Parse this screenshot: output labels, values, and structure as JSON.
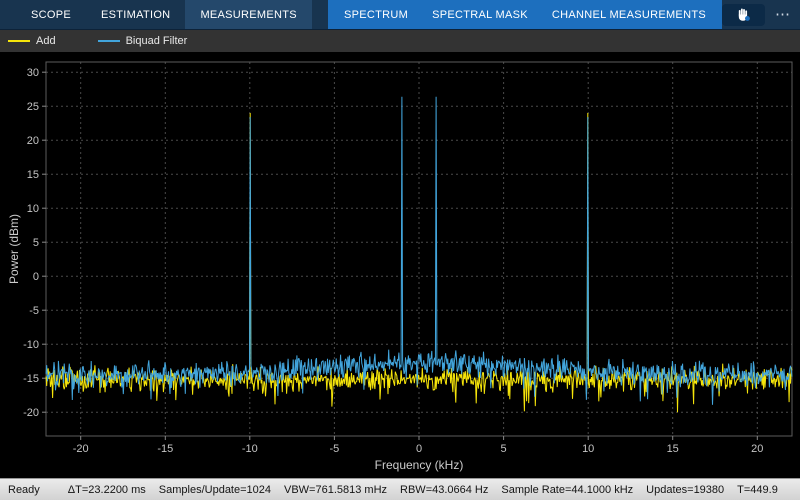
{
  "toolbar": {
    "tabs": [
      {
        "label": "SCOPE"
      },
      {
        "label": "ESTIMATION"
      },
      {
        "label": "MEASUREMENTS",
        "selected": true
      },
      {
        "label": "SPECTRUM"
      },
      {
        "label": "SPECTRAL MASK"
      },
      {
        "label": "CHANNEL MEASUREMENTS"
      }
    ],
    "blue_section_color": "#1d6fbe",
    "bar_color": "#18344f",
    "hand_icon": "hand-icon",
    "more_glyph": "⋯"
  },
  "legend": {
    "items": [
      {
        "label": "Add",
        "color": "#f6e50a"
      },
      {
        "label": "Biquad Filter",
        "color": "#42a5dc"
      }
    ]
  },
  "chart_data": {
    "type": "line",
    "title": "",
    "xlabel": "Frequency (kHz)",
    "ylabel": "Power (dBm)",
    "xlim": [
      -22.05,
      22.05
    ],
    "ylim": [
      -23.5,
      31.5
    ],
    "xticks": [
      -20,
      -15,
      -10,
      -5,
      0,
      5,
      10,
      15,
      20
    ],
    "yticks": [
      -20,
      -15,
      -10,
      -5,
      0,
      5,
      10,
      15,
      20,
      25,
      30
    ],
    "grid": true,
    "grid_color": "#4a4a4a",
    "background": "#000000",
    "legend_position": "top-left-strip",
    "n_points": 1024,
    "series": [
      {
        "name": "Add",
        "color": "#f6e50a",
        "noise_floor": -15.2,
        "noise_amp": 2.5,
        "peaks": [
          {
            "x": -10,
            "y": 24.0
          },
          {
            "x": 10,
            "y": 24.0
          }
        ]
      },
      {
        "name": "Biquad Filter",
        "color": "#42a5dc",
        "noise_floor": -14.6,
        "noise_amp": 2.5,
        "center_hump": {
          "amp": 2.0,
          "sigma": 9
        },
        "peaks": [
          {
            "x": -10,
            "y": 23.4
          },
          {
            "x": -1,
            "y": 26.4
          },
          {
            "x": 1,
            "y": 26.4
          },
          {
            "x": 10,
            "y": 23.4
          }
        ]
      }
    ]
  },
  "status_bar": {
    "ready": "Ready",
    "stats": [
      "ΔT=23.2200 ms",
      "Samples/Update=1024",
      "VBW=761.5813 mHz",
      "RBW=43.0664 Hz",
      "Sample Rate=44.1000 kHz",
      "Updates=19380",
      "T=449.9"
    ]
  }
}
